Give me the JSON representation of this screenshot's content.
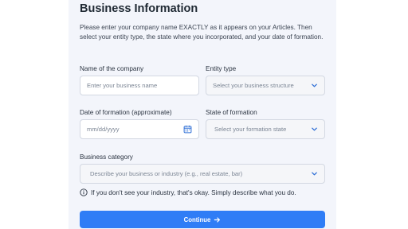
{
  "header": {
    "title": "Business Information",
    "intro": "Please enter your company name EXACTLY as it appears on your Articles. Then select your entity type, the state where you incorporated, and your date of formation."
  },
  "form": {
    "company_name": {
      "label": "Name of the company",
      "placeholder": "Enter your business name"
    },
    "entity_type": {
      "label": "Entity type",
      "value": "Select your business structure"
    },
    "formation_date": {
      "label": "Date of formation (approximate)",
      "placeholder": "mm/dd/yyyy"
    },
    "formation_state": {
      "label": "State of formation",
      "value": "Select your formation state"
    },
    "category": {
      "label": "Business category",
      "value": "Describe your business or industry (e.g., real estate, bar)"
    },
    "info_note": "If you don't see your industry, that's okay. Simply describe what you do."
  },
  "actions": {
    "continue_label": "Continue"
  },
  "colors": {
    "accent": "#2f7df6",
    "panel_bg": "#f3f5fb",
    "chevron": "#2f6fd6"
  },
  "icons": [
    "chevron-down-icon",
    "calendar-icon",
    "info-icon",
    "arrow-right-icon"
  ]
}
